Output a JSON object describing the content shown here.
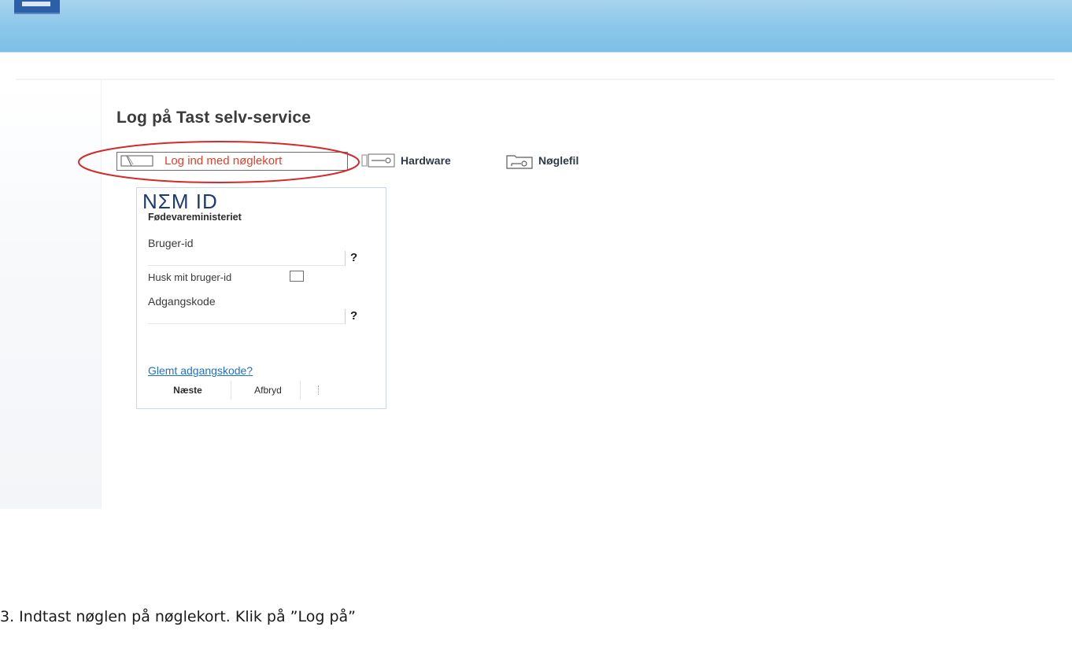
{
  "page": {
    "title": "Log på Tast selv-service"
  },
  "login_methods": [
    {
      "label": "Log ind med nøglekort",
      "icon": "card-icon",
      "selected": true
    },
    {
      "label": "Hardware",
      "icon": "hardware-key-icon",
      "selected": false
    },
    {
      "label": "Nøglefil",
      "icon": "key-file-icon",
      "selected": false
    }
  ],
  "login_box": {
    "logo": "NΣM ID",
    "organization": "Fødevareministeriet",
    "user_label": "Bruger-id",
    "user_value": "",
    "user_help": "?",
    "remember_label": "Husk mit bruger-id",
    "remember_checked": false,
    "password_label": "Adgangskode",
    "password_value": "",
    "password_help": "?",
    "forgot_link": "Glemt adgangskode?",
    "next_button": "Næste",
    "cancel_button": "Afbryd"
  },
  "instruction": "3. Indtast nøglen på nøglekort. Klik på ”Log på”",
  "colors": {
    "header_blue": "#8ec8ea",
    "selected_tab_text": "#e0402f",
    "annotation_ellipse": "#d42a2a",
    "nemid_navy": "#1d3a78",
    "link_blue": "#1e73c8"
  }
}
